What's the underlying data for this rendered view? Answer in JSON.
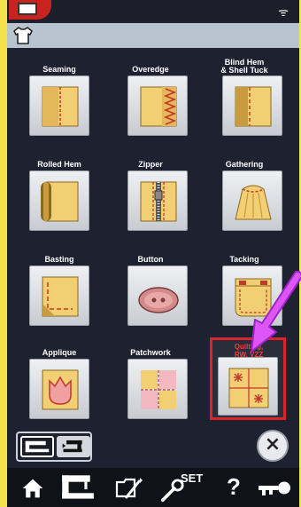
{
  "status_bar": {
    "wifi_glyph": "ᯤ"
  },
  "grid": {
    "items": [
      {
        "label_lines": [
          "Seaming"
        ],
        "name": "seaming"
      },
      {
        "label_lines": [
          "Overedge"
        ],
        "name": "overedge"
      },
      {
        "label_lines": [
          "Blind Hem",
          "& Shell Tuck"
        ],
        "name": "blind-hem-shell-tuck"
      },
      {
        "label_lines": [
          "Rolled Hem"
        ],
        "name": "rolled-hem"
      },
      {
        "label_lines": [
          "Zipper"
        ],
        "name": "zipper"
      },
      {
        "label_lines": [
          "Gathering"
        ],
        "name": "gathering"
      },
      {
        "label_lines": [
          "Basting"
        ],
        "name": "basting"
      },
      {
        "label_lines": [
          "Button"
        ],
        "name": "button"
      },
      {
        "label_lines": [
          "Tacking"
        ],
        "name": "tacking"
      },
      {
        "label_lines": [
          "Applique"
        ],
        "name": "applique"
      },
      {
        "label_lines": [
          "Patchwork"
        ],
        "name": "patchwork"
      }
    ],
    "selected": {
      "label_lines": [
        "Quilting,",
        "RW, VZZ"
      ],
      "name": "quilting-rw-vzz"
    }
  },
  "navbar": {
    "set_label": "SET",
    "help_label": "?",
    "icons": [
      "home-icon",
      "sewing-machine-icon",
      "folder-icon",
      "settings-wrench-icon",
      "help-icon",
      "key-icon"
    ]
  },
  "colors": {
    "accent_red": "#d8242a",
    "annotation_purple": "#cc44ee",
    "fabric_yellow": "#f2cf73",
    "background_navy": "#1d2130"
  }
}
